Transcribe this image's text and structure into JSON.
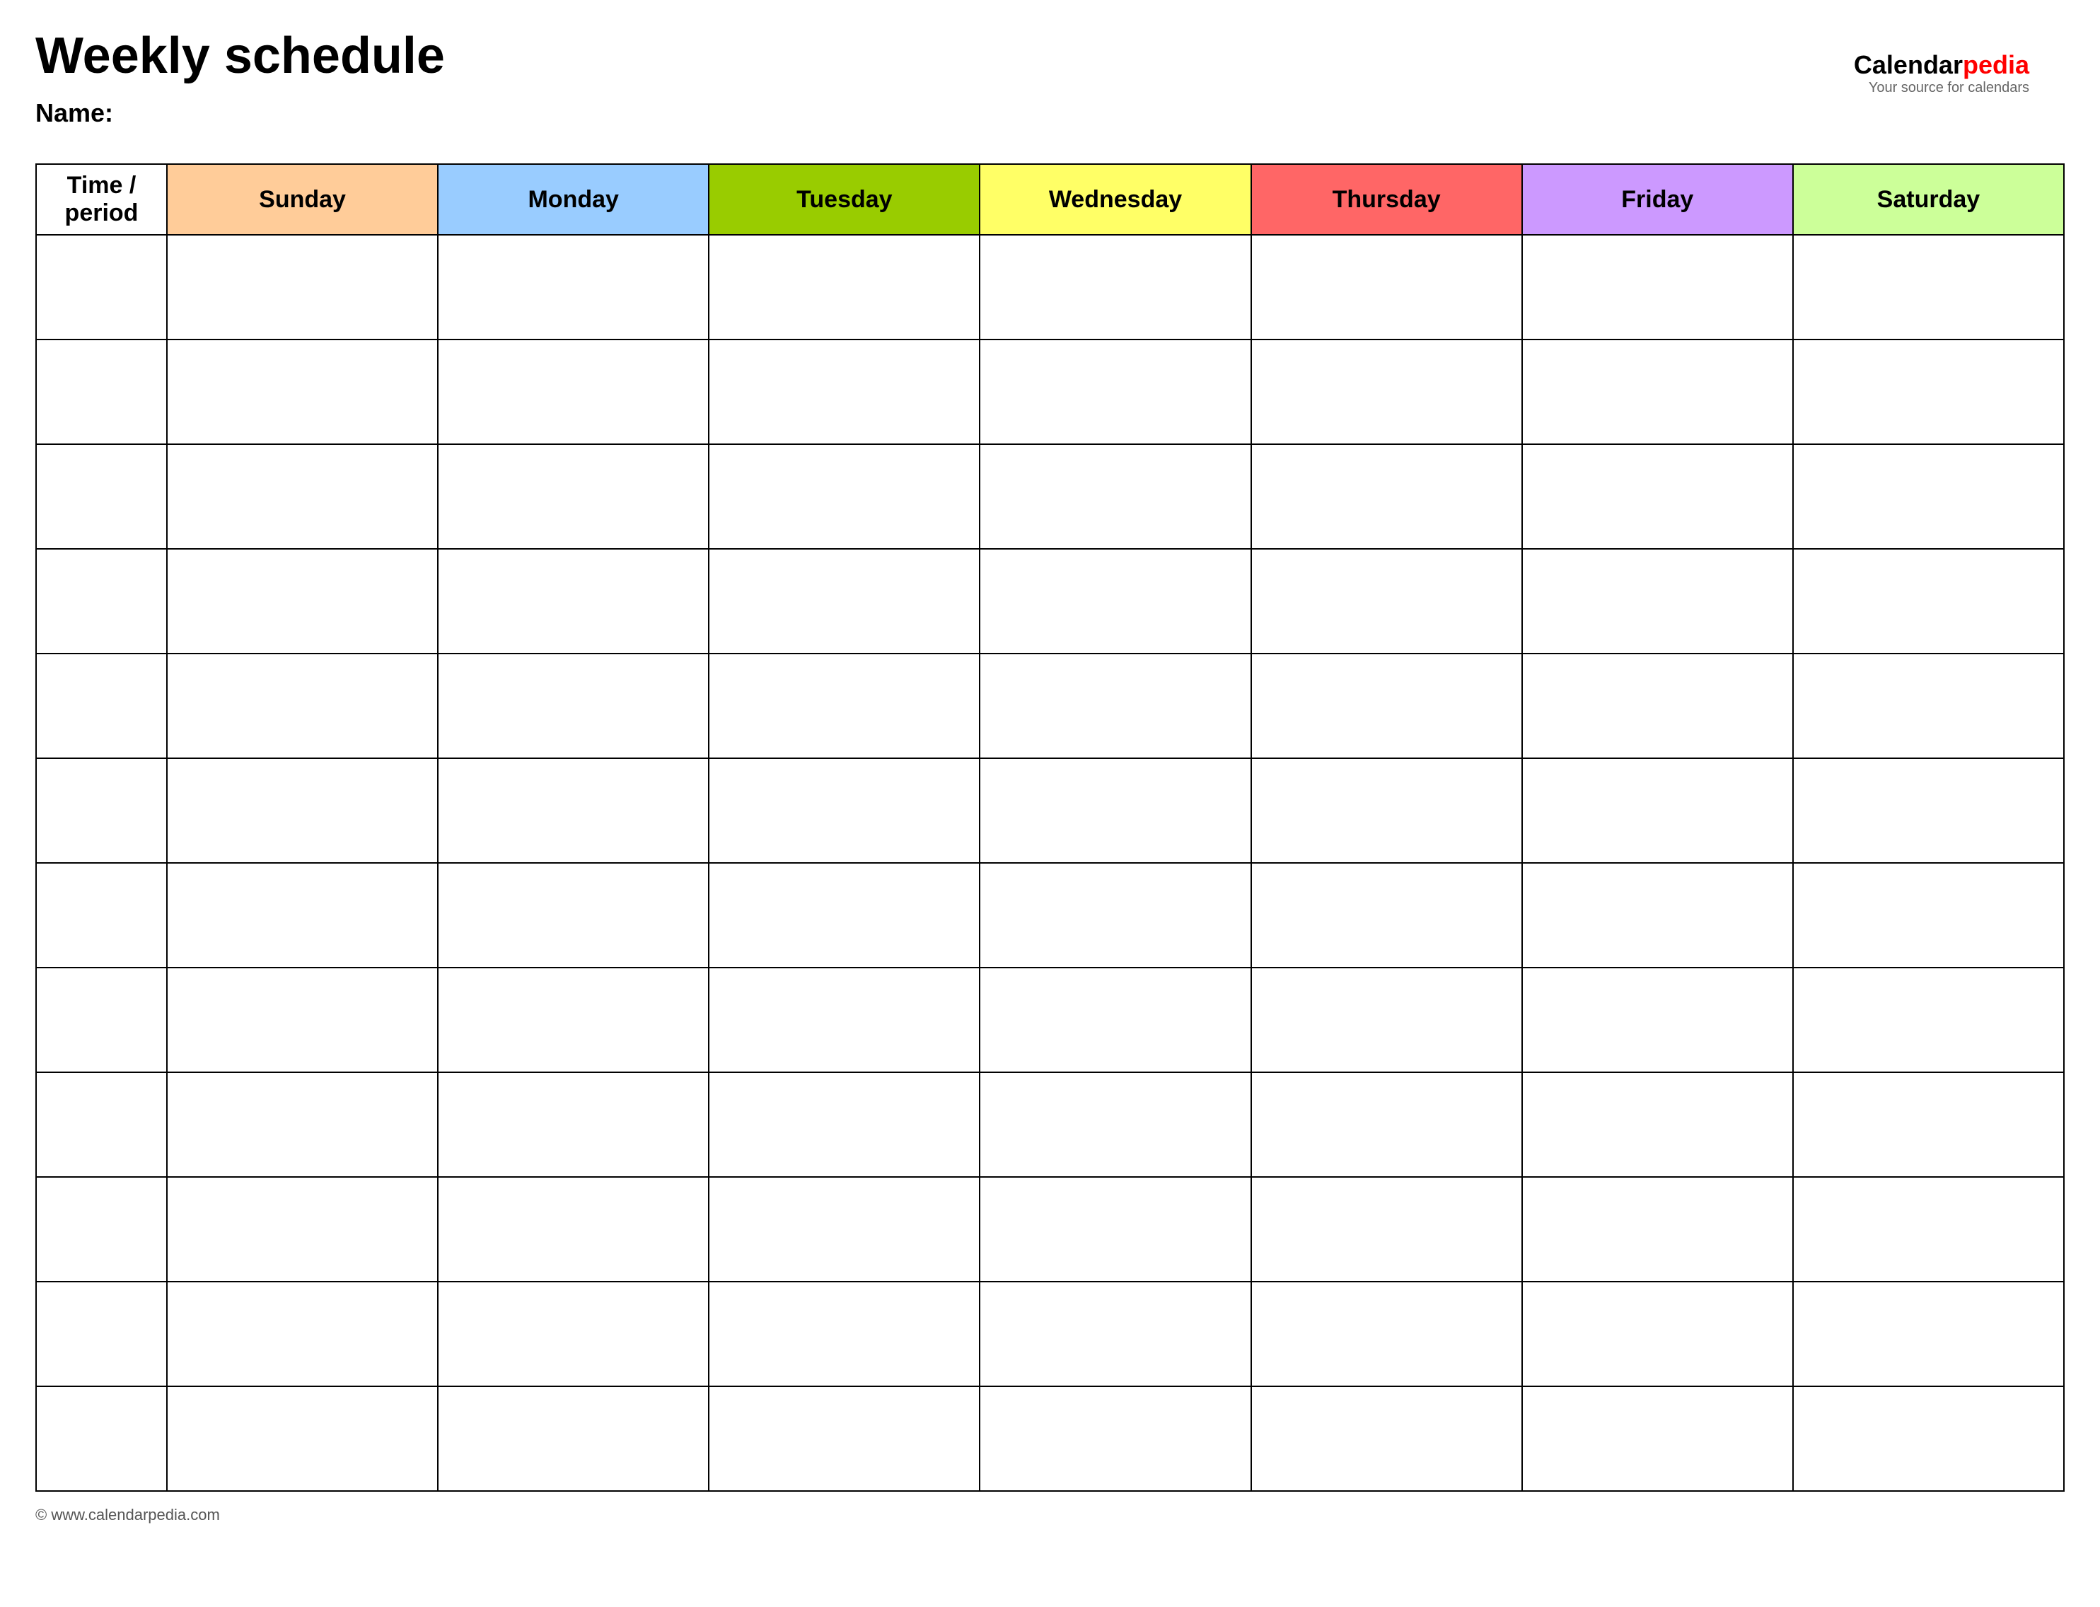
{
  "page": {
    "title": "Weekly schedule",
    "name_label": "Name:",
    "footer": "© www.calendarpedia.com"
  },
  "logo": {
    "calendar_text": "Calendar",
    "pedia_text": "pedia",
    "tagline": "Your source for calendars"
  },
  "table": {
    "headers": [
      {
        "id": "time",
        "label": "Time / period",
        "color": "#ffffff",
        "class": "header-time"
      },
      {
        "id": "sunday",
        "label": "Sunday",
        "color": "#ffcc99",
        "class": "header-sunday"
      },
      {
        "id": "monday",
        "label": "Monday",
        "color": "#99ccff",
        "class": "header-monday"
      },
      {
        "id": "tuesday",
        "label": "Tuesday",
        "color": "#99cc00",
        "class": "header-tuesday"
      },
      {
        "id": "wednesday",
        "label": "Wednesday",
        "color": "#ffff66",
        "class": "header-wednesday"
      },
      {
        "id": "thursday",
        "label": "Thursday",
        "color": "#ff6666",
        "class": "header-thursday"
      },
      {
        "id": "friday",
        "label": "Friday",
        "color": "#cc99ff",
        "class": "header-friday"
      },
      {
        "id": "saturday",
        "label": "Saturday",
        "color": "#ccff99",
        "class": "header-saturday"
      }
    ],
    "row_count": 12
  }
}
